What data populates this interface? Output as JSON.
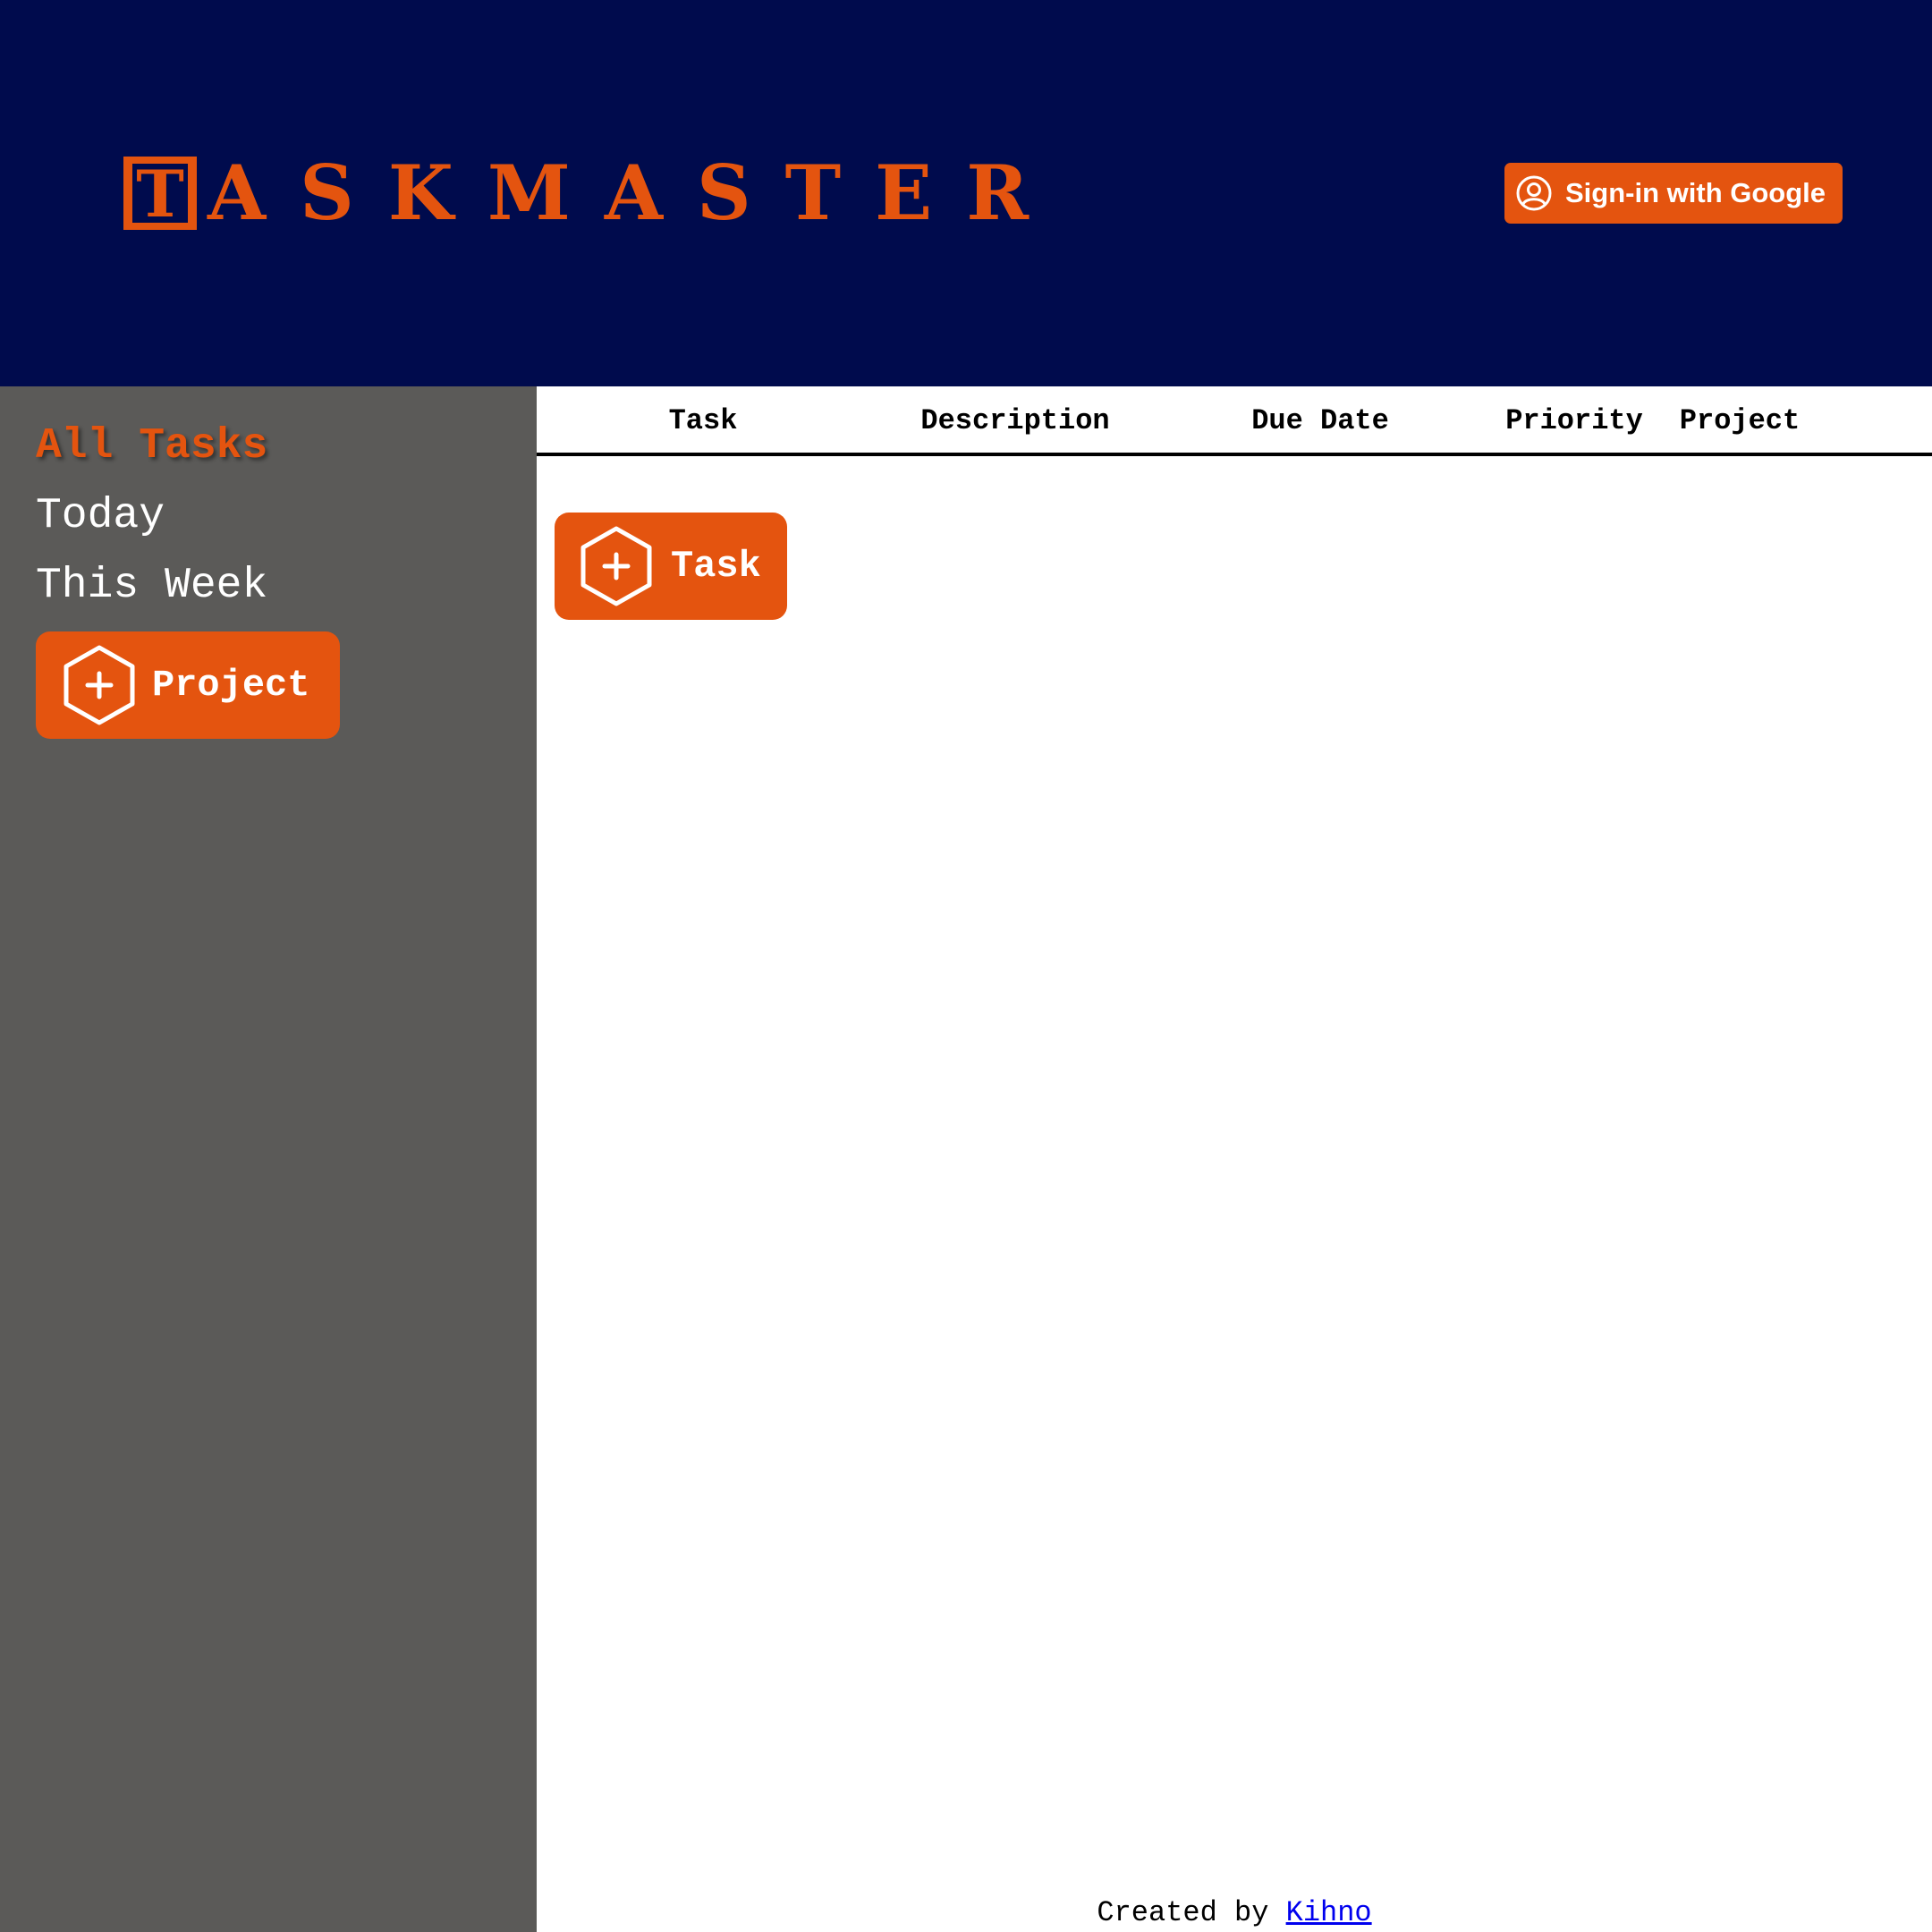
{
  "header": {
    "logo_letter": "T",
    "logo_text": "ASKMASTER",
    "signin_label": "Sign-in with Google"
  },
  "sidebar": {
    "items": [
      {
        "label": "All Tasks",
        "active": true
      },
      {
        "label": "Today",
        "active": false
      },
      {
        "label": "This Week",
        "active": false
      }
    ],
    "add_project_label": "Project"
  },
  "table": {
    "columns": [
      "Task",
      "Description",
      "Due Date",
      "Priority",
      "Project"
    ]
  },
  "main": {
    "add_task_label": "Task"
  },
  "footer": {
    "prefix": "Created by",
    "author": "Kihno"
  },
  "colors": {
    "header_bg": "#000b4d",
    "accent": "#e4540f",
    "sidebar_bg": "#5b5a58"
  },
  "icons": {
    "signin": "user-circle-icon",
    "add": "hexagon-plus-icon"
  }
}
